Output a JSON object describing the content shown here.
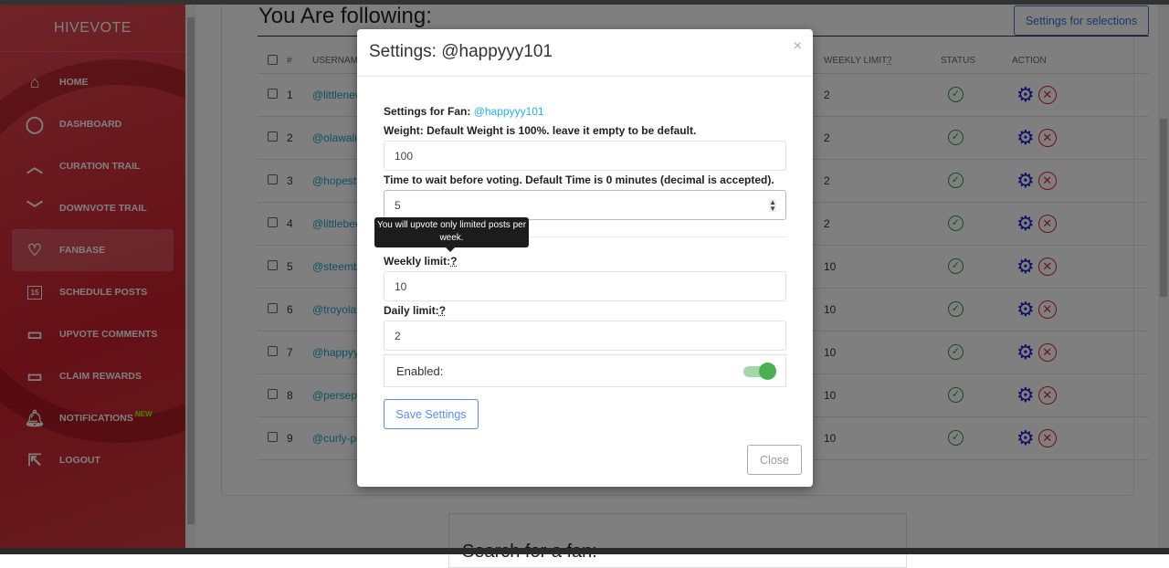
{
  "app": {
    "logo": "HIVEVOTE"
  },
  "sidebar": {
    "items": [
      {
        "label": "HOME",
        "icon": "home-icon"
      },
      {
        "label": "DASHBOARD",
        "icon": "user-icon"
      },
      {
        "label": "CURATION TRAIL",
        "icon": "chevron-up-circle-icon"
      },
      {
        "label": "DOWNVOTE TRAIL",
        "icon": "chevron-down-circle-icon"
      },
      {
        "label": "FANBASE",
        "icon": "heart-icon",
        "active": true
      },
      {
        "label": "SCHEDULE POSTS",
        "icon": "calendar-icon",
        "icon_text": "15"
      },
      {
        "label": "UPVOTE COMMENTS",
        "icon": "comment-icon"
      },
      {
        "label": "CLAIM REWARDS",
        "icon": "wallet-icon"
      },
      {
        "label": "NOTIFICATIONS",
        "icon": "bell-icon",
        "badge": "NEW"
      },
      {
        "label": "LOGOUT",
        "icon": "logout-icon"
      }
    ]
  },
  "main": {
    "title": "You Are following:",
    "settings_selections_label": "Settings for selections",
    "table": {
      "headers": {
        "num": "#",
        "username": "USERNAME",
        "weekly": "WEEKLY LIMIT",
        "q": "?",
        "status": "STATUS",
        "action": "ACTION"
      },
      "rows": [
        {
          "n": "1",
          "user": "@littlenew",
          "weekly": "2"
        },
        {
          "n": "2",
          "user": "@olawaliu",
          "weekly": "2"
        },
        {
          "n": "3",
          "user": "@hopesty",
          "weekly": "2"
        },
        {
          "n": "4",
          "user": "@littlebee",
          "weekly": "2"
        },
        {
          "n": "5",
          "user": "@steemb",
          "weekly": "10"
        },
        {
          "n": "6",
          "user": "@troyola",
          "weekly": "10"
        },
        {
          "n": "7",
          "user": "@happyyy",
          "weekly": "10"
        },
        {
          "n": "8",
          "user": "@perseph",
          "weekly": "10"
        },
        {
          "n": "9",
          "user": "@curly-pie",
          "weekly": "10"
        }
      ]
    },
    "search_title": "Search for a fan:"
  },
  "modal": {
    "title": "Settings: @happyyy101",
    "close_x": "×",
    "fan_label": "Settings for Fan:",
    "fan_name": "@happyyy101",
    "weight_label": "Weight: Default Weight is 100%. leave it empty to be default.",
    "weight_value": "100",
    "time_label": "Time to wait before voting. Default Time is 0 minutes (decimal is accepted).",
    "time_value": "5",
    "tooltip": "You will upvote only limited posts per week.",
    "weekly_label": "Weekly limit:",
    "weekly_value": "10",
    "daily_label": "Daily limit:",
    "daily_value": "2",
    "q": "?",
    "enabled_label": "Enabled:",
    "enabled": true,
    "save_label": "Save Settings",
    "close_label": "Close"
  },
  "colors": {
    "accent": "#3a6fd8",
    "link": "#1ca0c8",
    "ok": "#2a9a3a",
    "danger": "#e02030",
    "toggle": "#4caf50"
  }
}
